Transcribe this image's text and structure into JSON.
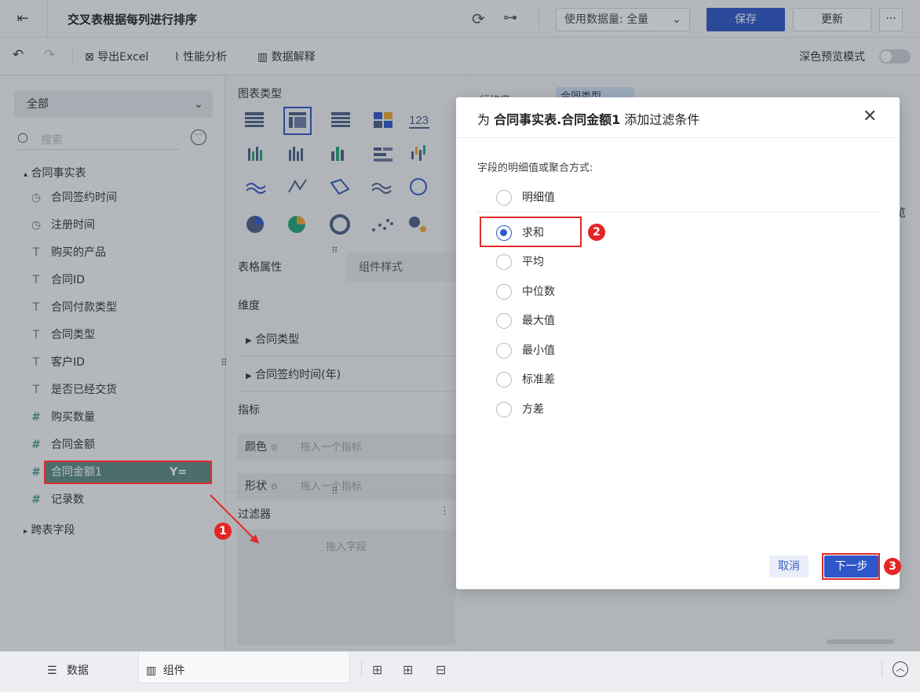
{
  "topbar": {
    "title": "交叉表根据每列进行排序",
    "data_volume": "使用数据量: 全量",
    "save": "保存",
    "update": "更新",
    "more": "···"
  },
  "toolbar": {
    "export": "导出Excel",
    "perf": "性能分析",
    "explain": "数据解释",
    "dark_preview": "深色预览模式"
  },
  "left": {
    "scope": "全部",
    "search_placeholder": "搜索",
    "group": "合同事实表",
    "fields": [
      {
        "label": "合同签约时间",
        "type": "time"
      },
      {
        "label": "注册时间",
        "type": "time"
      },
      {
        "label": "购买的产品",
        "type": "text"
      },
      {
        "label": "合同ID",
        "type": "text"
      },
      {
        "label": "合同付款类型",
        "type": "text"
      },
      {
        "label": "合同类型",
        "type": "text"
      },
      {
        "label": "客户ID",
        "type": "text"
      },
      {
        "label": "是否已经交货",
        "type": "text"
      },
      {
        "label": "购买数量",
        "type": "number"
      },
      {
        "label": "合同金额",
        "type": "number"
      },
      {
        "label": "合同金额1",
        "type": "number"
      },
      {
        "label": "记录数",
        "type": "number"
      }
    ],
    "cross_table": "跨表字段"
  },
  "middle": {
    "chart_type_title": "图表类型",
    "chart_number_icon": "123",
    "tab_properties": "表格属性",
    "tab_style": "组件样式",
    "dimension": "维度",
    "dims": [
      "合同类型",
      "合同签约时间(年)"
    ],
    "measure": "指标",
    "color_label": "颜色",
    "color_drop": "拖入一个指标",
    "shape_label": "形状",
    "shape_drop": "拖入一个指标",
    "filter_title": "过滤器",
    "filter_drop": "拖入字段"
  },
  "right": {
    "row_dim": "行维度",
    "col_chip": "合同类型",
    "side_text": "览"
  },
  "bottom": {
    "data": "数据",
    "component": "组件"
  },
  "dialog": {
    "title_prefix": "为 ",
    "title_field": "合同事实表.合同金额1",
    "title_suffix": " 添加过滤条件",
    "label": "字段的明细值或聚合方式:",
    "options": [
      "明细值",
      "求和",
      "平均",
      "中位数",
      "最大值",
      "最小值",
      "标准差",
      "方差"
    ],
    "selected": "求和",
    "cancel": "取消",
    "next": "下一步"
  },
  "annotations": [
    "1",
    "2",
    "3"
  ],
  "colors": {
    "primary": "#2e56c9",
    "highlight_red": "#e22a2a",
    "selected_field_bg": "#5e8a86"
  }
}
